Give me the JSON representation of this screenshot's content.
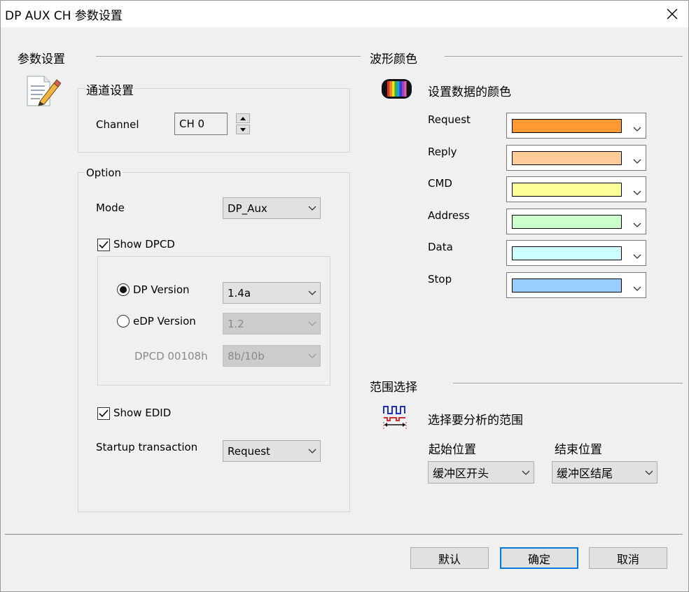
{
  "window": {
    "title": "DP AUX CH 参数设置"
  },
  "params": {
    "section_title": "参数设置",
    "channel_group": {
      "title": "通道设置",
      "channel_label": "Channel",
      "channel_value": "CH 0"
    },
    "option_group": {
      "title": "Option",
      "mode_label": "Mode",
      "mode_value": "DP_Aux",
      "show_dpcd": {
        "label": "Show DPCD",
        "checked": true
      },
      "dp_version": {
        "label": "DP Version",
        "value": "1.4a",
        "selected": true
      },
      "edp_version": {
        "label": "eDP Version",
        "value": "1.2",
        "selected": false
      },
      "dpcd_00108h": {
        "label": "DPCD 00108h",
        "value": "8b/10b"
      },
      "show_edid": {
        "label": "Show EDID",
        "checked": true
      },
      "startup": {
        "label": "Startup transaction",
        "value": "Request"
      }
    }
  },
  "wave_colors": {
    "section_title": "波形颜色",
    "subtitle": "设置数据的颜色",
    "items": [
      {
        "label": "Request",
        "color": "#ff9933"
      },
      {
        "label": "Reply",
        "color": "#ffcc99"
      },
      {
        "label": "CMD",
        "color": "#ffff99"
      },
      {
        "label": "Address",
        "color": "#ccffcc"
      },
      {
        "label": "Data",
        "color": "#ccffff"
      },
      {
        "label": "Stop",
        "color": "#99ccff"
      }
    ]
  },
  "range": {
    "section_title": "范围选择",
    "subtitle": "选择要分析的范围",
    "start_label": "起始位置",
    "start_value": "缓冲区开头",
    "end_label": "结束位置",
    "end_value": "缓冲区结尾"
  },
  "buttons": {
    "default": "默认",
    "ok": "确定",
    "cancel": "取消"
  }
}
